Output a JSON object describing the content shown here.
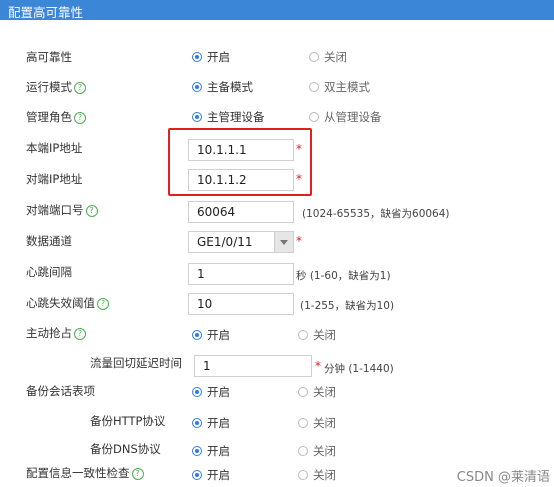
{
  "title": "配置高可靠性",
  "rows": {
    "ha": {
      "label": "高可靠性",
      "opt1": "开启",
      "opt2": "关闭"
    },
    "mode": {
      "label": "运行模式",
      "opt1": "主备模式",
      "opt2": "双主模式"
    },
    "role": {
      "label": "管理角色",
      "opt1": "主管理设备",
      "opt2": "从管理设备"
    },
    "local_ip": {
      "label": "本端IP地址",
      "value": "10.1.1.1",
      "req": "*"
    },
    "peer_ip": {
      "label": "对端IP地址",
      "value": "10.1.1.2",
      "req": "*"
    },
    "peer_port": {
      "label": "对端端口号",
      "value": "60064",
      "hint": "(1024-65535，缺省为60064)"
    },
    "channel": {
      "label": "数据通道",
      "value": "GE1/0/11",
      "req": "*"
    },
    "heartbeat": {
      "label": "心跳间隔",
      "value": "1",
      "hint": "秒 (1-60，缺省为1)"
    },
    "hb_threshold": {
      "label": "心跳失效阈值",
      "value": "10",
      "hint": "(1-255，缺省为10)"
    },
    "preempt": {
      "label": "主动抢占",
      "opt1": "开启",
      "opt2": "关闭"
    },
    "switchback": {
      "label": "流量回切延迟时间",
      "value": "1",
      "req": "*",
      "hint": "分钟 (1-1440)"
    },
    "backup_session": {
      "label": "备份会话表项",
      "opt1": "开启",
      "opt2": "关闭"
    },
    "backup_http": {
      "label": "备份HTTP协议",
      "opt1": "开启",
      "opt2": "关闭"
    },
    "backup_dns": {
      "label": "备份DNS协议",
      "opt1": "开启",
      "opt2": "关闭"
    },
    "consistency": {
      "label": "配置信息一致性检查",
      "opt1": "开启",
      "opt2": "关闭"
    }
  },
  "watermark": "CSDN @莱清语",
  "help_glyph": "?",
  "colors": {
    "title_bar": "#3b86d6",
    "accent": "#2f7fd8",
    "required": "#e02020",
    "highlight": "#e02020"
  }
}
